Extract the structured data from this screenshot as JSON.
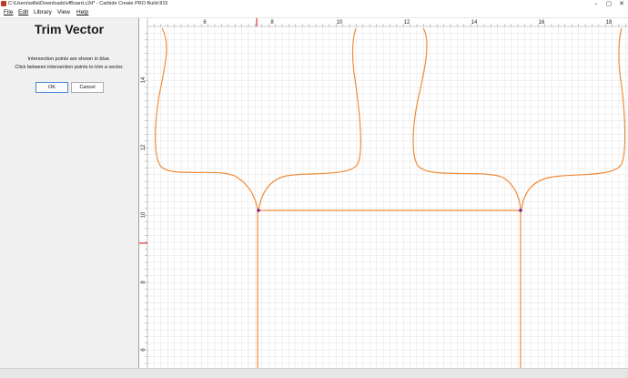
{
  "window": {
    "title": "C:\\Users\\willa\\Downloads\\vfBoard.c2d* - Carbide Create PRO Build 815",
    "controls": [
      "–",
      "▢",
      "✕"
    ]
  },
  "menu": [
    "File",
    "Edit",
    "Library",
    "View",
    "Help"
  ],
  "panel": {
    "title": "Trim Vector",
    "line1": "Intersection points are shown in blue.",
    "line2": "Click between intersection points to trim a vector.",
    "ok_label": "OK",
    "cancel_label": "Cancel"
  },
  "canvas": {
    "x_ruler_labels": [
      "6",
      "8",
      "10",
      "12",
      "14",
      "16",
      "18"
    ],
    "y_ruler_labels": [
      "14",
      "12",
      "10",
      "8",
      "6"
    ],
    "colors": {
      "grid": "#e3e3e3",
      "vector": "#f08c3a",
      "intersection_point": "#7b1fa2",
      "ruler_marker": "#e03030"
    }
  }
}
